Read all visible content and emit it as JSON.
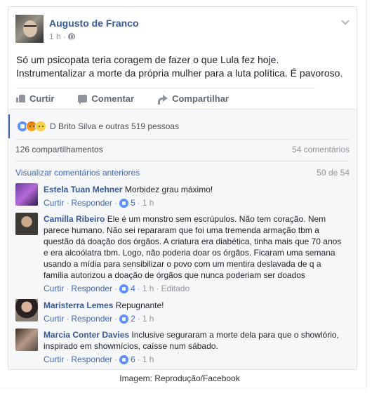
{
  "post": {
    "author": "Augusto de Franco",
    "time": "1 h",
    "meta_dot": "·",
    "text": "Só um psicopata teria coragem de fazer o que Lula fez hoje. Instrumentalizar a morte da própria mulher para a luta política. É pavoroso."
  },
  "actions": {
    "like": "Curtir",
    "comment": "Comentar",
    "share": "Compartilhar"
  },
  "reactions": {
    "text": "D Brito Silva e outras 519 pessoas",
    "icons": [
      "like-reaction-icon",
      "angry-reaction-icon",
      "sad-reaction-icon"
    ]
  },
  "stats": {
    "shares": "126 compartilhamentos",
    "comments": "54 comentários"
  },
  "previous": {
    "link": "Visualizar comentários anteriores",
    "count": "50 de 54"
  },
  "comments": [
    {
      "name": "Estela Tuan Mehner",
      "text": "Morbidez grau máximo!",
      "like": "Curtir",
      "reply": "Responder",
      "likes": "5",
      "time": "1 h",
      "edited": ""
    },
    {
      "name": "Camilla Ribeiro",
      "text": "Ele é um monstro sem escrúpulos. Não tem coração. Nem parece humano. Não sei repararam que foi uma tremenda armação tbm a questão dá doação dos órgãos. A criatura era diabética, tinha mais que 70 anos e era alcoólatra tbm. Logo, não poderia doar os órgãos. Ficaram uma semana usando a mídia para sensibilizar o povo com um mentira deslavada de q a família autorizou a doação de órgãos que nunca poderiam ser doados",
      "like": "Curtir",
      "reply": "Responder",
      "likes": "4",
      "time": "1 h",
      "edited": "Editado"
    },
    {
      "name": "Maristerra Lemes",
      "text": "Repugnante!",
      "like": "Curtir",
      "reply": "Responder",
      "likes": "2",
      "time": "1 h",
      "edited": ""
    },
    {
      "name": "Marcia Conter Davies",
      "text": "Inclusive seguraram a morte dela para que o showlório, inspirado em showmícios, caísse num sábado.",
      "like": "Curtir",
      "reply": "Responder",
      "likes": "6",
      "time": "1 h",
      "edited": ""
    }
  ],
  "caption": "Imagem: Reprodução/Facebook",
  "colors": {
    "link_blue": "#365899",
    "action_blue": "#4267b2",
    "muted": "#90949c",
    "like_blue": "#5890ff"
  }
}
